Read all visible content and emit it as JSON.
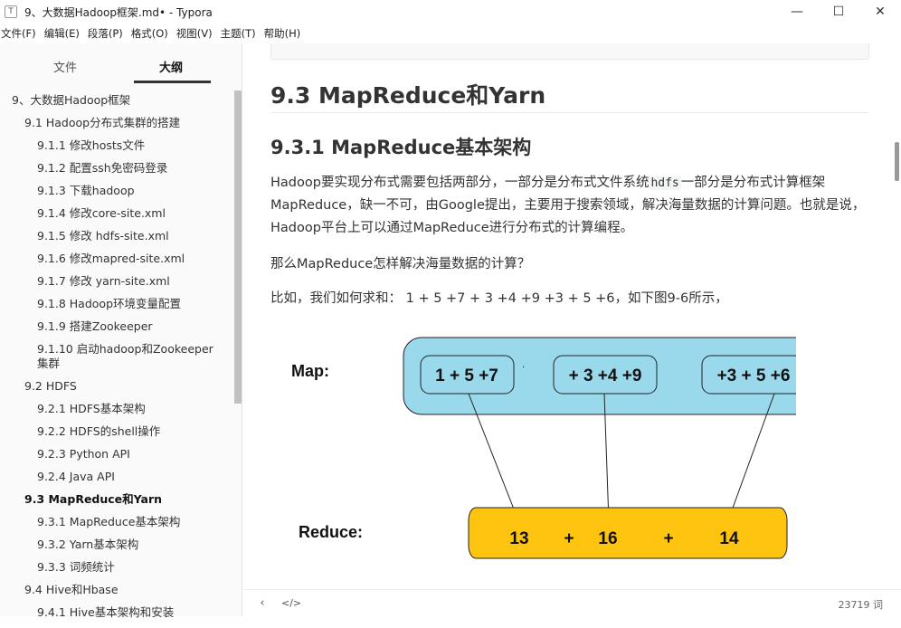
{
  "window": {
    "app_icon": "T",
    "title": "9、大数据Hadoop框架.md• - Typora",
    "buttons": {
      "minimize": "—",
      "maximize": "☐",
      "close": "✕"
    }
  },
  "menu": [
    "文件(F)",
    "编辑(E)",
    "段落(P)",
    "格式(O)",
    "视图(V)",
    "主题(T)",
    "帮助(H)"
  ],
  "sidebar": {
    "tabs": {
      "files": "文件",
      "outline": "大纲"
    },
    "outline": [
      {
        "label": "9、大数据Hadoop框架",
        "level": 1
      },
      {
        "label": "9.1 Hadoop分布式集群的搭建",
        "level": 2
      },
      {
        "label": "9.1.1 修改hosts文件",
        "level": 3
      },
      {
        "label": "9.1.2 配置ssh免密码登录",
        "level": 3
      },
      {
        "label": "9.1.3 下载hadoop",
        "level": 3
      },
      {
        "label": "9.1.4 修改core-site.xml",
        "level": 3
      },
      {
        "label": "9.1.5 修改 hdfs-site.xml",
        "level": 3
      },
      {
        "label": "9.1.6 修改mapred-site.xml",
        "level": 3
      },
      {
        "label": "9.1.7 修改 yarn-site.xml",
        "level": 3
      },
      {
        "label": "9.1.8 Hadoop环境变量配置",
        "level": 3
      },
      {
        "label": "9.1.9 搭建Zookeeper",
        "level": 3
      },
      {
        "label": "9.1.10 启动hadoop和Zookeeper集群",
        "level": 3
      },
      {
        "label": "9.2 HDFS",
        "level": 2
      },
      {
        "label": "9.2.1 HDFS基本架构",
        "level": 3
      },
      {
        "label": "9.2.2 HDFS的shell操作",
        "level": 3
      },
      {
        "label": "9.2.3 Python API",
        "level": 3
      },
      {
        "label": "9.2.4 Java API",
        "level": 3
      },
      {
        "label": "9.3 MapReduce和Yarn",
        "level": 2,
        "active": true
      },
      {
        "label": "9.3.1 MapReduce基本架构",
        "level": 3
      },
      {
        "label": "9.3.2 Yarn基本架构",
        "level": 3
      },
      {
        "label": "9.3.3 词频统计",
        "level": 3
      },
      {
        "label": "9.4 Hive和Hbase",
        "level": 2
      },
      {
        "label": "9.4.1 Hive基本架构和安装",
        "level": 3
      }
    ]
  },
  "content": {
    "h2": "9.3 MapReduce和Yarn",
    "h3": "9.3.1 MapReduce基本架构",
    "p1_a": "Hadoop要实现分布式需要包括两部分，一部分是分布式文件系统",
    "p1_code": "hdfs",
    "p1_b": "一部分是分布式计算框架MapReduce，缺一不可，由Google提出，主要用于搜索领域，解决海量数据的计算问题。也就是说，Hadoop平台上可以通过MapReduce进行分布式的计算编程。",
    "p2": "那么MapReduce怎样解决海量数据的计算？",
    "p3": "比如，我们如何求和： 1 + 5 +7 + 3 +4 +9 +3 + 5 +6，如下图9-6所示，"
  },
  "diagram": {
    "map_label": "Map:",
    "reduce_label": "Reduce:",
    "map_boxes": [
      "1 + 5 +7",
      "+ 3 +4 +9",
      "+3 + 5 +6"
    ],
    "dot": ".",
    "reduce_values": [
      "13",
      "16",
      "14"
    ],
    "plus": "+",
    "colors": {
      "map_fill": "#9ad9ec",
      "reduce_fill": "#ffc410",
      "stroke": "#222222"
    }
  },
  "footer": {
    "back_icon": "chevron-left-icon",
    "back": "‹",
    "source_icon": "code-icon",
    "source": "</>",
    "word_count": "23719 词"
  }
}
